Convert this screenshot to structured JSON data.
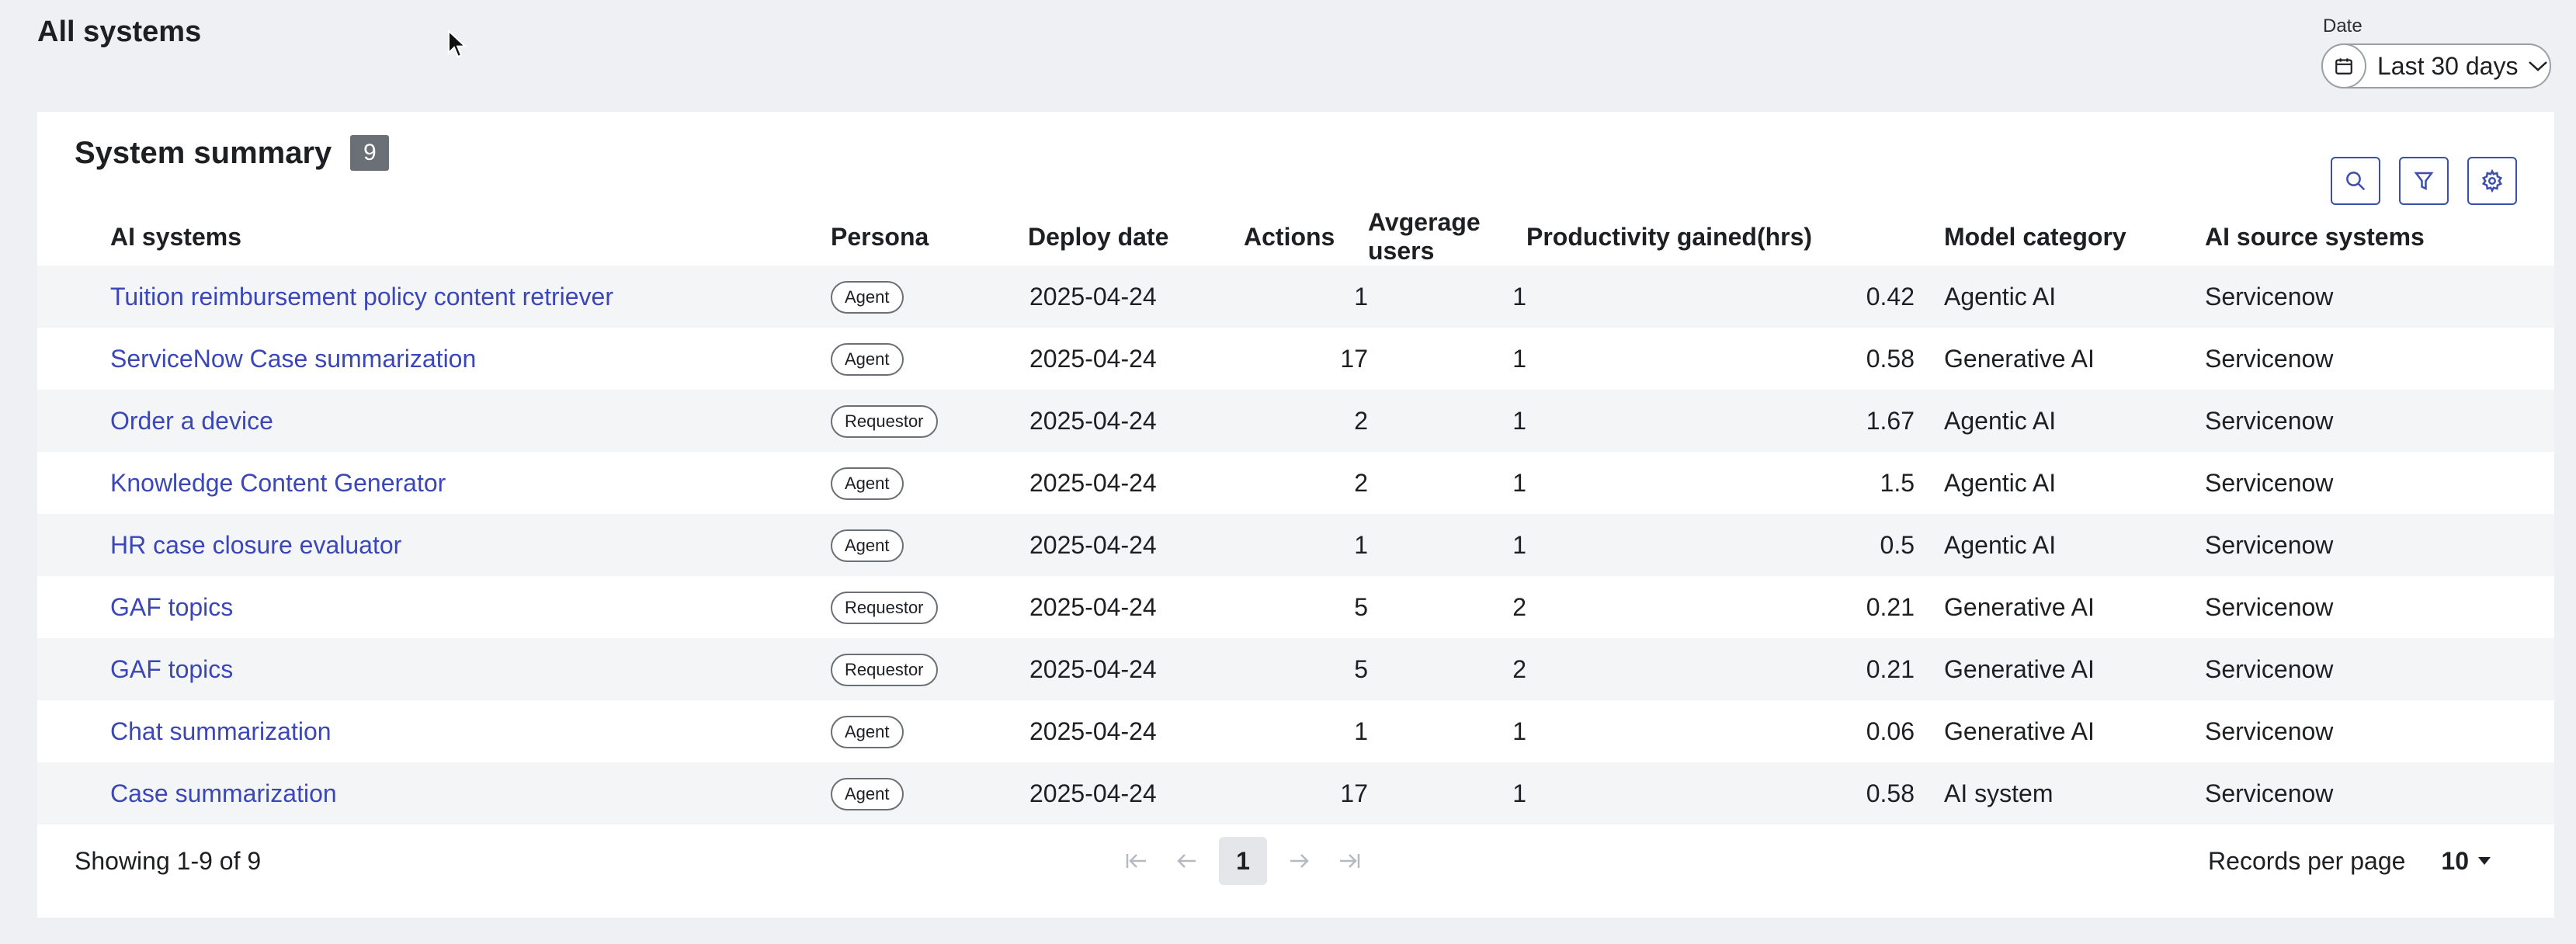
{
  "page": {
    "title": "All systems"
  },
  "date_filter": {
    "label": "Date",
    "value": "Last 30 days"
  },
  "summary": {
    "title": "System summary",
    "count": "9",
    "tools": [
      "search-icon",
      "filter-icon",
      "gear-icon"
    ]
  },
  "table": {
    "headers": {
      "name": "AI systems",
      "persona": "Persona",
      "deploy_date": "Deploy date",
      "actions": "Actions",
      "avg_users": "Avgerage users",
      "productivity": "Productivity gained(hrs)",
      "model_category": "Model category",
      "source": "AI source systems"
    },
    "rows": [
      {
        "name": "Tuition reimbursement policy content retriever",
        "persona": "Agent",
        "deploy_date": "2025-04-24",
        "actions": "1",
        "avg_users": "1",
        "productivity": "0.42",
        "model_category": "Agentic AI",
        "source": "Servicenow"
      },
      {
        "name": "ServiceNow Case summarization",
        "persona": "Agent",
        "deploy_date": "2025-04-24",
        "actions": "17",
        "avg_users": "1",
        "productivity": "0.58",
        "model_category": "Generative AI",
        "source": "Servicenow"
      },
      {
        "name": "Order a device",
        "persona": "Requestor",
        "deploy_date": "2025-04-24",
        "actions": "2",
        "avg_users": "1",
        "productivity": "1.67",
        "model_category": "Agentic AI",
        "source": "Servicenow"
      },
      {
        "name": "Knowledge Content Generator",
        "persona": "Agent",
        "deploy_date": "2025-04-24",
        "actions": "2",
        "avg_users": "1",
        "productivity": "1.5",
        "model_category": "Agentic AI",
        "source": "Servicenow"
      },
      {
        "name": "HR case closure evaluator",
        "persona": "Agent",
        "deploy_date": "2025-04-24",
        "actions": "1",
        "avg_users": "1",
        "productivity": "0.5",
        "model_category": "Agentic AI",
        "source": "Servicenow"
      },
      {
        "name": "GAF topics",
        "persona": "Requestor",
        "deploy_date": "2025-04-24",
        "actions": "5",
        "avg_users": "2",
        "productivity": "0.21",
        "model_category": "Generative AI",
        "source": "Servicenow"
      },
      {
        "name": "GAF topics",
        "persona": "Requestor",
        "deploy_date": "2025-04-24",
        "actions": "5",
        "avg_users": "2",
        "productivity": "0.21",
        "model_category": "Generative AI",
        "source": "Servicenow"
      },
      {
        "name": "Chat summarization",
        "persona": "Agent",
        "deploy_date": "2025-04-24",
        "actions": "1",
        "avg_users": "1",
        "productivity": "0.06",
        "model_category": "Generative AI",
        "source": "Servicenow"
      },
      {
        "name": "Case summarization",
        "persona": "Agent",
        "deploy_date": "2025-04-24",
        "actions": "17",
        "avg_users": "1",
        "productivity": "0.58",
        "model_category": "AI system",
        "source": "Servicenow"
      }
    ]
  },
  "pagination": {
    "showing": "Showing 1-9 of 9",
    "current_page": "1",
    "records_label": "Records per page",
    "records_value": "10"
  },
  "colors": {
    "link": "#3b47b8",
    "accent_border": "#3b4fa8",
    "badge_bg": "#6b6f76",
    "row_alt": "#f4f5f7"
  }
}
